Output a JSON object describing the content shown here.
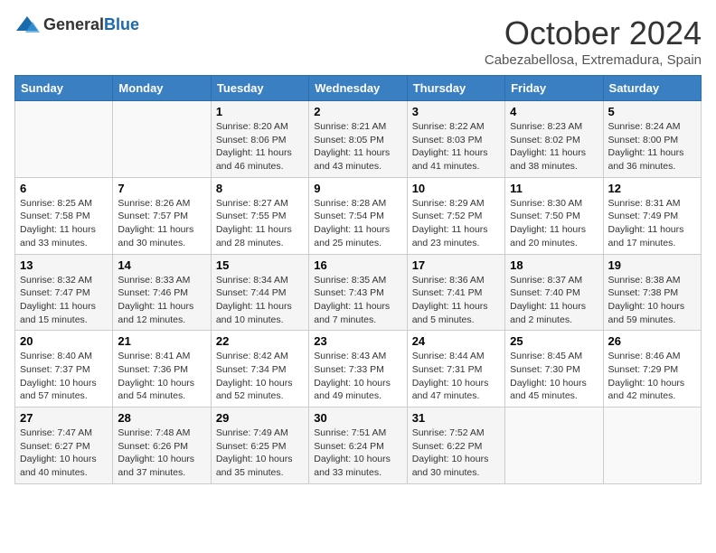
{
  "header": {
    "logo_general": "General",
    "logo_blue": "Blue",
    "title": "October 2024",
    "location": "Cabezabellosa, Extremadura, Spain"
  },
  "weekdays": [
    "Sunday",
    "Monday",
    "Tuesday",
    "Wednesday",
    "Thursday",
    "Friday",
    "Saturday"
  ],
  "weeks": [
    [
      {
        "day": "",
        "detail": ""
      },
      {
        "day": "",
        "detail": ""
      },
      {
        "day": "1",
        "detail": "Sunrise: 8:20 AM\nSunset: 8:06 PM\nDaylight: 11 hours and 46 minutes."
      },
      {
        "day": "2",
        "detail": "Sunrise: 8:21 AM\nSunset: 8:05 PM\nDaylight: 11 hours and 43 minutes."
      },
      {
        "day": "3",
        "detail": "Sunrise: 8:22 AM\nSunset: 8:03 PM\nDaylight: 11 hours and 41 minutes."
      },
      {
        "day": "4",
        "detail": "Sunrise: 8:23 AM\nSunset: 8:02 PM\nDaylight: 11 hours and 38 minutes."
      },
      {
        "day": "5",
        "detail": "Sunrise: 8:24 AM\nSunset: 8:00 PM\nDaylight: 11 hours and 36 minutes."
      }
    ],
    [
      {
        "day": "6",
        "detail": "Sunrise: 8:25 AM\nSunset: 7:58 PM\nDaylight: 11 hours and 33 minutes."
      },
      {
        "day": "7",
        "detail": "Sunrise: 8:26 AM\nSunset: 7:57 PM\nDaylight: 11 hours and 30 minutes."
      },
      {
        "day": "8",
        "detail": "Sunrise: 8:27 AM\nSunset: 7:55 PM\nDaylight: 11 hours and 28 minutes."
      },
      {
        "day": "9",
        "detail": "Sunrise: 8:28 AM\nSunset: 7:54 PM\nDaylight: 11 hours and 25 minutes."
      },
      {
        "day": "10",
        "detail": "Sunrise: 8:29 AM\nSunset: 7:52 PM\nDaylight: 11 hours and 23 minutes."
      },
      {
        "day": "11",
        "detail": "Sunrise: 8:30 AM\nSunset: 7:50 PM\nDaylight: 11 hours and 20 minutes."
      },
      {
        "day": "12",
        "detail": "Sunrise: 8:31 AM\nSunset: 7:49 PM\nDaylight: 11 hours and 17 minutes."
      }
    ],
    [
      {
        "day": "13",
        "detail": "Sunrise: 8:32 AM\nSunset: 7:47 PM\nDaylight: 11 hours and 15 minutes."
      },
      {
        "day": "14",
        "detail": "Sunrise: 8:33 AM\nSunset: 7:46 PM\nDaylight: 11 hours and 12 minutes."
      },
      {
        "day": "15",
        "detail": "Sunrise: 8:34 AM\nSunset: 7:44 PM\nDaylight: 11 hours and 10 minutes."
      },
      {
        "day": "16",
        "detail": "Sunrise: 8:35 AM\nSunset: 7:43 PM\nDaylight: 11 hours and 7 minutes."
      },
      {
        "day": "17",
        "detail": "Sunrise: 8:36 AM\nSunset: 7:41 PM\nDaylight: 11 hours and 5 minutes."
      },
      {
        "day": "18",
        "detail": "Sunrise: 8:37 AM\nSunset: 7:40 PM\nDaylight: 11 hours and 2 minutes."
      },
      {
        "day": "19",
        "detail": "Sunrise: 8:38 AM\nSunset: 7:38 PM\nDaylight: 10 hours and 59 minutes."
      }
    ],
    [
      {
        "day": "20",
        "detail": "Sunrise: 8:40 AM\nSunset: 7:37 PM\nDaylight: 10 hours and 57 minutes."
      },
      {
        "day": "21",
        "detail": "Sunrise: 8:41 AM\nSunset: 7:36 PM\nDaylight: 10 hours and 54 minutes."
      },
      {
        "day": "22",
        "detail": "Sunrise: 8:42 AM\nSunset: 7:34 PM\nDaylight: 10 hours and 52 minutes."
      },
      {
        "day": "23",
        "detail": "Sunrise: 8:43 AM\nSunset: 7:33 PM\nDaylight: 10 hours and 49 minutes."
      },
      {
        "day": "24",
        "detail": "Sunrise: 8:44 AM\nSunset: 7:31 PM\nDaylight: 10 hours and 47 minutes."
      },
      {
        "day": "25",
        "detail": "Sunrise: 8:45 AM\nSunset: 7:30 PM\nDaylight: 10 hours and 45 minutes."
      },
      {
        "day": "26",
        "detail": "Sunrise: 8:46 AM\nSunset: 7:29 PM\nDaylight: 10 hours and 42 minutes."
      }
    ],
    [
      {
        "day": "27",
        "detail": "Sunrise: 7:47 AM\nSunset: 6:27 PM\nDaylight: 10 hours and 40 minutes."
      },
      {
        "day": "28",
        "detail": "Sunrise: 7:48 AM\nSunset: 6:26 PM\nDaylight: 10 hours and 37 minutes."
      },
      {
        "day": "29",
        "detail": "Sunrise: 7:49 AM\nSunset: 6:25 PM\nDaylight: 10 hours and 35 minutes."
      },
      {
        "day": "30",
        "detail": "Sunrise: 7:51 AM\nSunset: 6:24 PM\nDaylight: 10 hours and 33 minutes."
      },
      {
        "day": "31",
        "detail": "Sunrise: 7:52 AM\nSunset: 6:22 PM\nDaylight: 10 hours and 30 minutes."
      },
      {
        "day": "",
        "detail": ""
      },
      {
        "day": "",
        "detail": ""
      }
    ]
  ]
}
